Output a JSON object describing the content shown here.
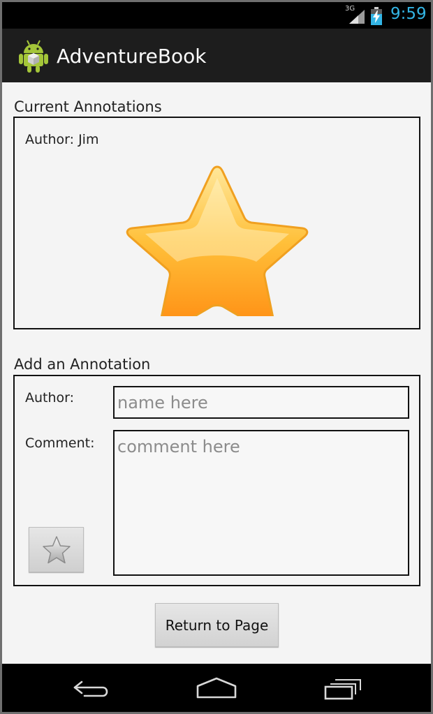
{
  "status_bar": {
    "network": "3G",
    "time": "9:59"
  },
  "action_bar": {
    "app_title": "AdventureBook",
    "icon": "android-robot-icon"
  },
  "current_annotations": {
    "section_title": "Current Annotations",
    "author_line": "Author: Jim",
    "image": "gold-star-icon"
  },
  "add_annotation": {
    "section_title": "Add an Annotation",
    "author_label": "Author:",
    "author_value": "",
    "author_placeholder": "name here",
    "comment_label": "Comment:",
    "comment_value": "",
    "comment_placeholder": "comment here",
    "star_button_icon": "star-icon"
  },
  "return_button_label": "Return to Page",
  "nav_bar": {
    "back": "back-icon",
    "home": "home-icon",
    "recents": "recent-apps-icon"
  },
  "colors": {
    "clock": "#33b5e5",
    "action_bar": "#1d1d1d",
    "background": "#f4f4f4"
  }
}
